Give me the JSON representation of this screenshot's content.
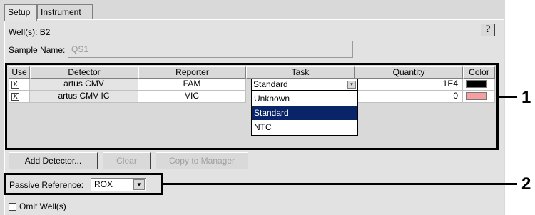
{
  "tabs": {
    "setup": "Setup",
    "instrument": "Instrument"
  },
  "wells_label": "Well(s): B2",
  "help_label": "?",
  "sample": {
    "label": "Sample Name:",
    "value": "QS1"
  },
  "table": {
    "headers": [
      "Use",
      "Detector",
      "Reporter",
      "Task",
      "Quantity",
      "Color"
    ],
    "rows": [
      {
        "use": "X",
        "detector": "artus CMV",
        "reporter": "FAM",
        "task": "Standard",
        "quantity": "1E4",
        "color": "#000000"
      },
      {
        "use": "X",
        "detector": "artus CMV IC",
        "reporter": "VIC",
        "task": "",
        "quantity": "0",
        "color": "#f4a0a0"
      }
    ],
    "task_dropdown": {
      "selected": "Standard",
      "options": [
        "Unknown",
        "Standard",
        "NTC"
      ]
    }
  },
  "buttons": {
    "add_detector": "Add Detector...",
    "clear": "Clear",
    "copy_to_manager": "Copy to Manager"
  },
  "passive_reference": {
    "label": "Passive Reference:",
    "value": "ROX"
  },
  "omit_wells": "Omit Well(s)",
  "callouts": [
    "1",
    "2"
  ],
  "colors": {
    "selection": "#0a246a",
    "panel": "#d9d9d9"
  }
}
